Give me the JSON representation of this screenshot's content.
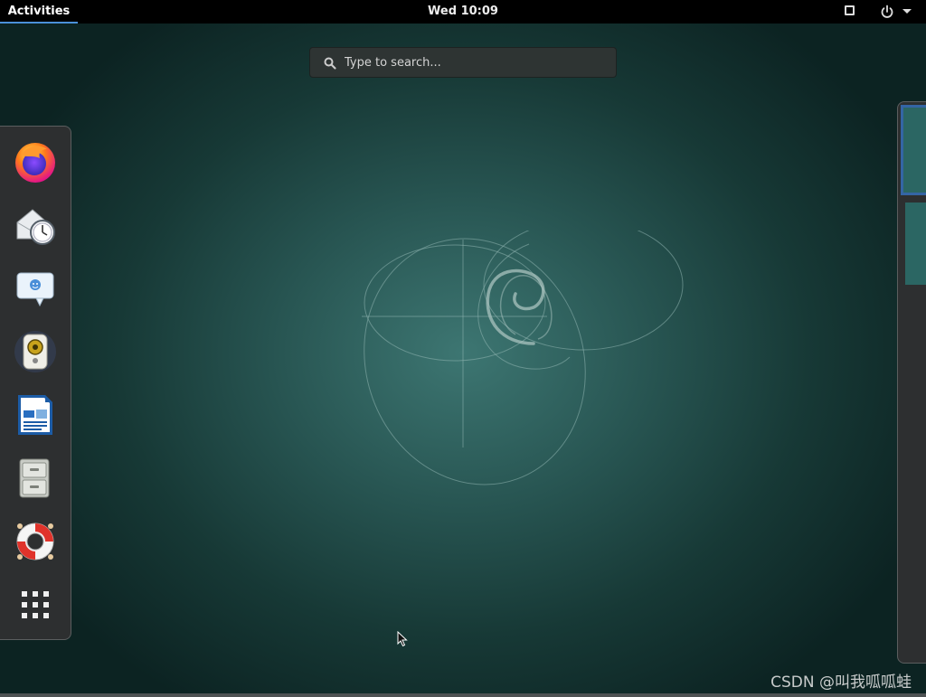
{
  "topbar": {
    "activities_label": "Activities",
    "clock": "Wed 10:09"
  },
  "search": {
    "placeholder": "Type to search..."
  },
  "dash": {
    "items": [
      {
        "name": "firefox-icon"
      },
      {
        "name": "evolution-mail-calendar-icon"
      },
      {
        "name": "empathy-chat-icon"
      },
      {
        "name": "rhythmbox-music-icon"
      },
      {
        "name": "libreoffice-writer-icon"
      },
      {
        "name": "files-cabinet-icon"
      },
      {
        "name": "help-lifebuoy-icon"
      },
      {
        "name": "show-applications-grid-icon"
      }
    ]
  },
  "workspaces": {
    "count": 2,
    "active": 1
  },
  "watermark": "CSDN @叫我呱呱蛙"
}
